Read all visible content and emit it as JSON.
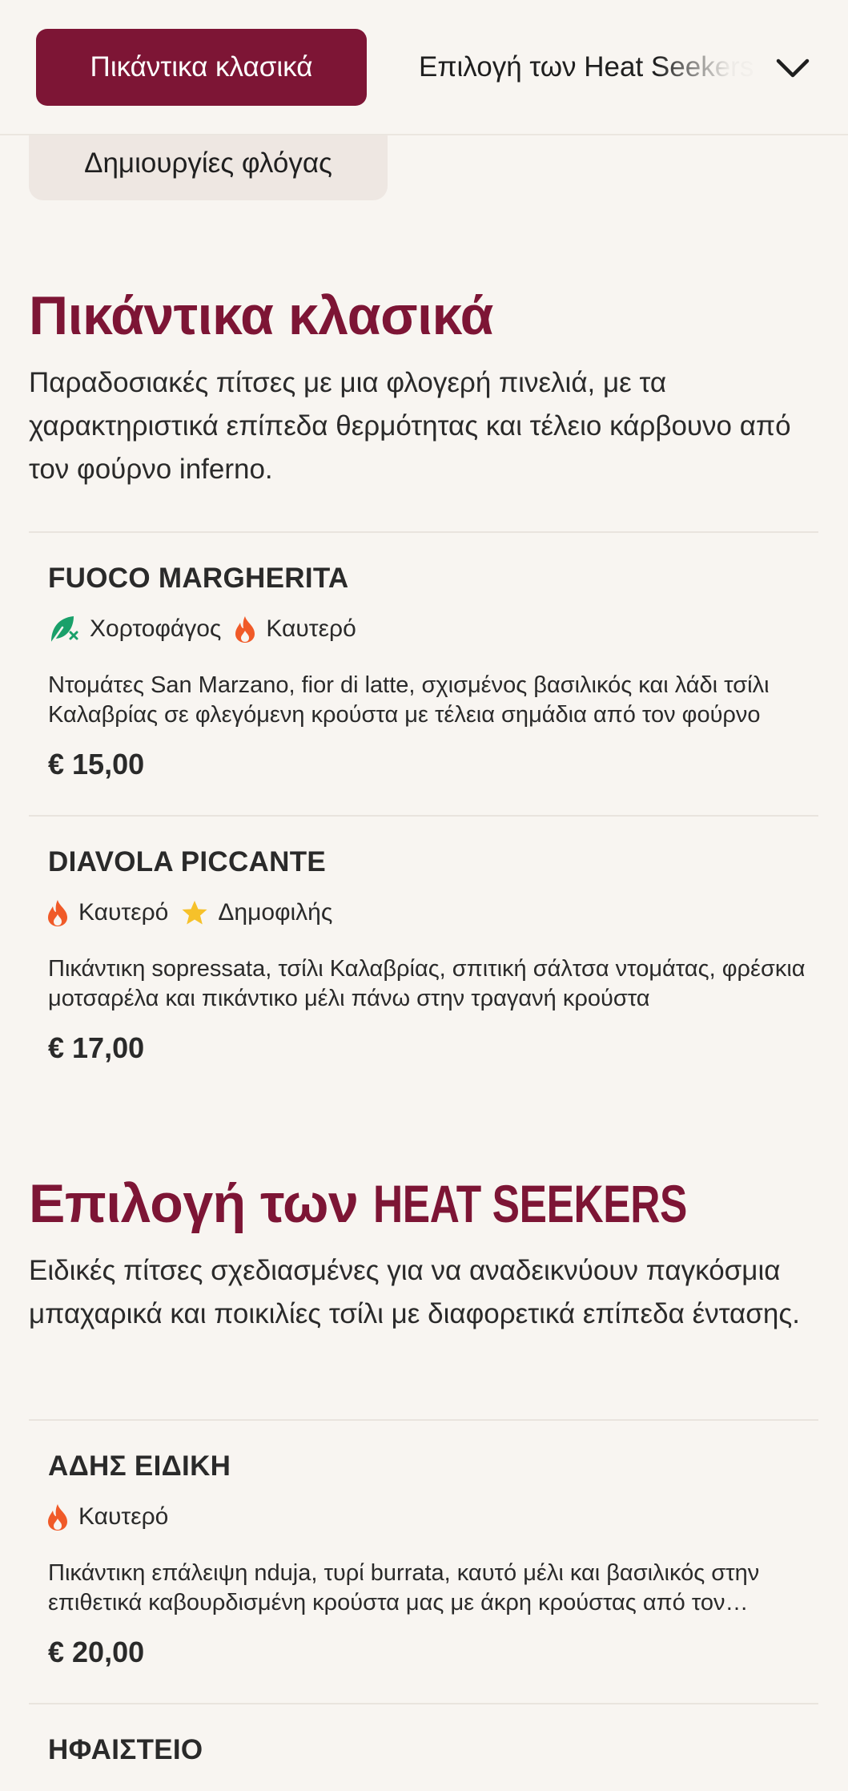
{
  "header": {
    "active_tab": "Πικάντικα κλασικά",
    "second_tab": "Επιλογή των Heat Seekers",
    "third_tab": "Δημιουργίες φλόγας"
  },
  "sections": [
    {
      "title": "Πικάντικα κλασικά",
      "description": "Παραδοσιακές πίτσες με μια φλογερή πινελιά, με τα χαρακτηριστικά επίπεδα θερμότητας και τέλειο κάρβουνο από τον φούρνο inferno.",
      "items": [
        {
          "name": "FUOCO MARGHERITA",
          "tags": [
            "Χορτοφάγος",
            "Καυτερό"
          ],
          "description": "Ντομάτες San Marzano, fior di latte, σχισμένος βασιλικός και λάδι τσίλι Καλαβρίας σε φλεγόμενη κρούστα με τέλεια σημάδια από τον φούρνο",
          "price": "€ 15,00"
        },
        {
          "name": "DIAVOLA PICCANTE",
          "tags": [
            "Καυτερό",
            "Δημοφιλής"
          ],
          "description": "Πικάντικη sopressata, τσίλι Καλαβρίας, σπιτική σάλτσα ντομάτας, φρέσκια μοτσαρέλα και πικάντικο μέλι πάνω στην τραγανή κρούστα",
          "price": "€ 17,00"
        }
      ]
    },
    {
      "title_prefix": "Επιλογή των ",
      "title_brand": "HEAT SEEKERS",
      "description": "Ειδικές πίτσες σχεδιασμένες για να αναδεικνύουν παγκόσμια μπαχαρικά και ποικιλίες τσίλι με διαφορετικά επίπεδα έντασης.",
      "items": [
        {
          "name": "ΑΔΗΣ ΕΙΔΙΚΗ",
          "tags": [
            "Καυτερό"
          ],
          "description": "Πικάντικη επάλειψη nduja, τυρί burrata, καυτό μέλι και βασιλικός στην επιθετικά καβουρδισμένη κρούστα μας με άκρη κρούστας από τον φούρνο",
          "price": "€ 20,00"
        },
        {
          "name": "ΗΦΑΙΣΤΕΙΟ"
        }
      ]
    }
  ],
  "colors": {
    "brand": "#7d1535",
    "background": "#f8f5f1",
    "flame": "#f05a28",
    "vegetarian": "#1aa06a",
    "star": "#f6c12a"
  },
  "icons": {
    "vegetarian": "leaf-icon",
    "spicy": "flame-icon",
    "popular": "star-icon",
    "dropdown": "chevron-down-icon"
  }
}
